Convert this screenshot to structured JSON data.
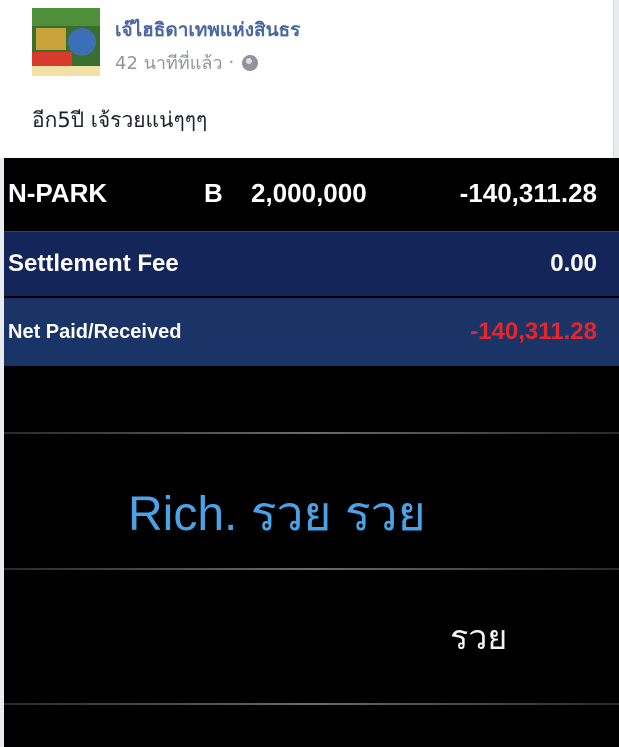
{
  "post": {
    "author": "เจ๊ไฮธิดาเทพแห่งสินธร",
    "time": "42 นาทีที่แล้ว",
    "separator": "·",
    "text": "อีก5ปี เจ้รวยแน่ๆๆๆ"
  },
  "trade": {
    "symbol": "N-PARK",
    "side": "B",
    "quantity": "2,000,000",
    "amount": "-140,311.28",
    "settlement_label": "Settlement Fee",
    "settlement_value": "0.00",
    "net_label": "Net Paid/Received",
    "net_value": "-140,311.28"
  },
  "overlay": {
    "rich_line": "Rich. รวย รวย",
    "rich_small": "รวย"
  },
  "colors": {
    "author": "#4b67a1",
    "fee_row": "#14255a",
    "net_row": "#1b3468",
    "negative": "#e4262c",
    "overlay_text": "#4aa3e6"
  }
}
